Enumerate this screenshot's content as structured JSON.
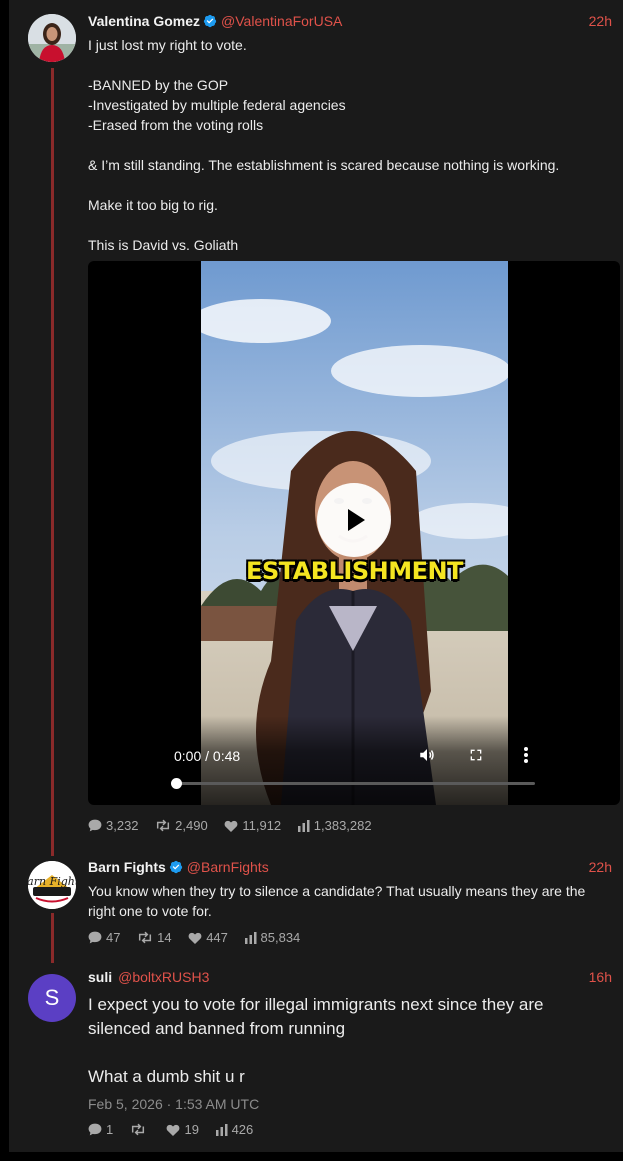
{
  "tweets": [
    {
      "author": "Valentina Gomez",
      "handle": "@ValentinaForUSA",
      "verified": true,
      "time": "22h",
      "lines": [
        "I just lost my right to vote.",
        "",
        "-BANNED by the GOP",
        "-Investigated by multiple federal agencies",
        "-Erased from the voting rolls",
        "",
        "& I’m still standing. The establishment is scared because nothing is working.",
        "",
        "Make it too big to rig.",
        "",
        "This is David vs. Goliath"
      ],
      "video": {
        "caption": "ESTABLISHMENT",
        "timecode": "0:00 / 0:48",
        "progress": 0
      },
      "stats": {
        "replies": "3,232",
        "reposts": "2,490",
        "likes": "11,912",
        "views": "1,383,282"
      }
    },
    {
      "author": "Barn Fights",
      "handle": "@BarnFights",
      "verified": true,
      "time": "22h",
      "avatar_text": "Barn Fights",
      "lines": [
        "You know when they try to silence a candidate? That usually means they are the right one to vote for."
      ],
      "stats": {
        "replies": "47",
        "reposts": "14",
        "likes": "447",
        "views": "85,834"
      }
    },
    {
      "author": "suli",
      "handle": "@boltxRUSH3",
      "verified": false,
      "time": "16h",
      "avatar_letter": "S",
      "avatar_color": "#5b3fc4",
      "lines": [
        "I expect you to vote for illegal immigrants next since they are silenced and banned from running",
        "",
        "What a dumb shit u r"
      ],
      "date": "Feb 5, 2026 · 1:53 AM UTC",
      "stats": {
        "replies": "1",
        "reposts": "",
        "likes": "19",
        "views": "426"
      }
    }
  ],
  "colors": {
    "accent": "#e0524a",
    "thread_line": "#8a2a2a",
    "background": "#1a1a1a",
    "verified": "#1d9bf0"
  },
  "icons": {
    "reply": "comment-icon",
    "repost": "repost-icon",
    "like": "heart-icon",
    "views": "bar-chart-icon",
    "verified": "verified-badge-icon"
  }
}
